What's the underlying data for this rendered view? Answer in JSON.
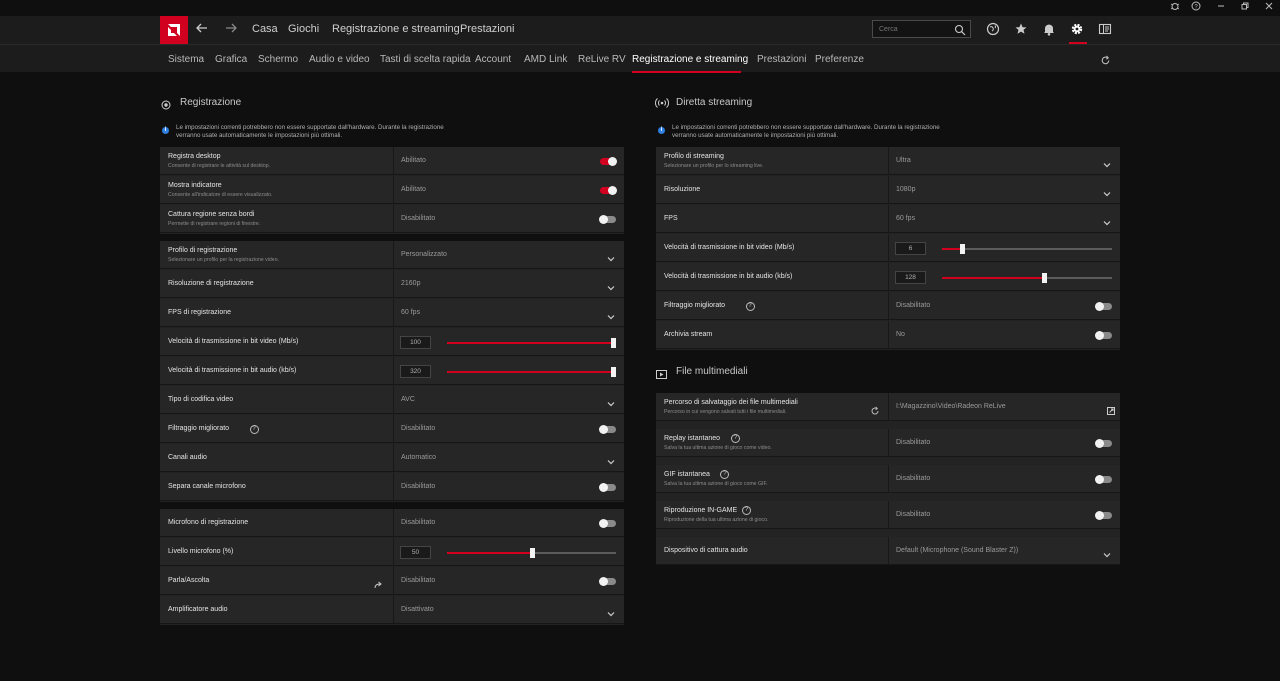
{
  "nav": {
    "links": [
      "Casa",
      "Giochi",
      "Registrazione e streaming",
      "Prestazioni"
    ],
    "search_placeholder": "Cerca"
  },
  "tabs": [
    "Sistema",
    "Grafica",
    "Schermo",
    "Audio e video",
    "Tasti di scelta rapida",
    "Account",
    "AMD Link",
    "ReLive RV",
    "Registrazione e streaming",
    "Prestazioni",
    "Preferenze"
  ],
  "recording": {
    "title": "Registrazione",
    "info": "Le impostazioni correnti potrebbero non essere supportate dall'hardware. Durante la registrazione verranno usate automaticamente le impostazioni più ottimali.",
    "group1": [
      {
        "label": "Registra desktop",
        "sub": "Consente di registrare le attività sul desktop.",
        "value": "Abilitato",
        "control": "toggle",
        "on": true
      },
      {
        "label": "Mostra indicatore",
        "sub": "Consente all'indicatore di essere visualizzato.",
        "value": "Abilitato",
        "control": "toggle",
        "on": true
      },
      {
        "label": "Cattura regione senza bordi",
        "sub": "Permette di registrare regioni di finestre.",
        "value": "Disabilitato",
        "control": "toggle",
        "on": false
      }
    ],
    "group2": [
      {
        "label": "Profilo di registrazione",
        "sub": "Selezionare un profilo per la registrazione video.",
        "value": "Personalizzato",
        "control": "dropdown"
      },
      {
        "label": "Risoluzione di registrazione",
        "value": "2160p",
        "control": "dropdown"
      },
      {
        "label": "FPS di registrazione",
        "value": "60 fps",
        "control": "dropdown"
      },
      {
        "label": "Velocità di trasmissione in bit video (Mb/s)",
        "value": "100",
        "control": "slider",
        "level": 1.0
      },
      {
        "label": "Velocità di trasmissione in bit audio (kb/s)",
        "value": "320",
        "control": "slider",
        "level": 1.0
      },
      {
        "label": "Tipo di codifica video",
        "value": "AVC",
        "control": "dropdown"
      },
      {
        "label": "Filtraggio migliorato",
        "value": "Disabilitato",
        "control": "toggle",
        "on": false,
        "help": true
      },
      {
        "label": "Canali audio",
        "value": "Automatico",
        "control": "dropdown"
      },
      {
        "label": "Separa canale microfono",
        "value": "Disabilitato",
        "control": "toggle",
        "on": false
      }
    ],
    "group3": [
      {
        "label": "Microfono di registrazione",
        "value": "Disabilitato",
        "control": "toggle",
        "on": false
      },
      {
        "label": "Livello microfono (%)",
        "value": "50",
        "control": "slider",
        "level": 0.5
      },
      {
        "label": "Parla/Ascolta",
        "value": "Disabilitato",
        "control": "toggle",
        "on": false,
        "share": true
      },
      {
        "label": "Amplificatore audio",
        "value": "Disattivato",
        "control": "dropdown"
      }
    ]
  },
  "streaming": {
    "title": "Diretta streaming",
    "info": "Le impostazioni correnti potrebbero non essere supportate dall'hardware. Durante la registrazione verranno usate automaticamente le impostazioni più ottimali.",
    "rows": [
      {
        "label": "Profilo di streaming",
        "sub": "Selezionare un profilo per lo streaming live.",
        "value": "Ultra",
        "control": "dropdown"
      },
      {
        "label": "Risoluzione",
        "value": "1080p",
        "control": "dropdown"
      },
      {
        "label": "FPS",
        "value": "60 fps",
        "control": "dropdown"
      },
      {
        "label": "Velocità di trasmissione in bit video (Mb/s)",
        "value": "6",
        "control": "slider",
        "level": 0.12
      },
      {
        "label": "Velocità di trasmissione in bit audio (kb/s)",
        "value": "128",
        "control": "slider",
        "level": 0.6
      },
      {
        "label": "Filtraggio migliorato",
        "value": "Disabilitato",
        "control": "toggle",
        "on": false,
        "help": true
      },
      {
        "label": "Archivia stream",
        "value": "No",
        "control": "toggle",
        "on": false
      }
    ]
  },
  "media": {
    "title": "File multimediali",
    "rows": [
      {
        "label": "Percorso di salvataggio dei file multimediali",
        "sub": "Percorso in cui vengono salvati tutti i file multimediali.",
        "value": "I:\\Magazzino\\Video\\Radeon ReLive",
        "control": "folder"
      },
      {
        "label": "Replay istantaneo",
        "sub": "Salva la tua ultima azione di gioco come video.",
        "value": "Disabilitato",
        "control": "toggle",
        "on": false,
        "help": true
      },
      {
        "label": "GIF istantanea",
        "sub": "Salva la tua ultima azione di gioco come GIF.",
        "value": "Disabilitato",
        "control": "toggle",
        "on": false,
        "help": true
      },
      {
        "label": "Riproduzione IN-GAME",
        "sub": "Riproduzione della tua ultima azione di gioco.",
        "value": "Disabilitato",
        "control": "toggle",
        "on": false,
        "help": true
      },
      {
        "label": "Dispositivo di cattura audio",
        "value": "Default (Microphone (Sound Blaster Z))",
        "control": "dropdown"
      }
    ]
  }
}
